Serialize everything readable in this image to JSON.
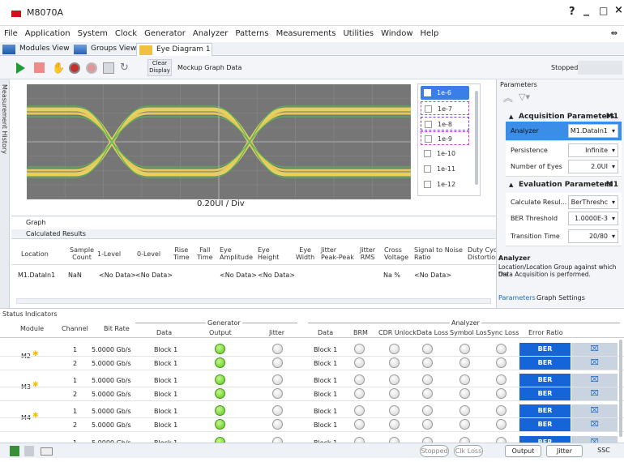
{
  "window": {
    "title": "M8070A",
    "controls": [
      "?",
      "_",
      "□",
      "×"
    ]
  },
  "menu": [
    "File",
    "Application",
    "System",
    "Clock",
    "Generator",
    "Analyzer",
    "Patterns",
    "Measurements",
    "Utilities",
    "Window",
    "Help"
  ],
  "tabs": [
    {
      "label": "Modules View",
      "icon": "modules-icon"
    },
    {
      "label": "Groups View",
      "icon": "groups-icon"
    },
    {
      "label": "Eye Diagram 1",
      "icon": "eye-diagram-icon",
      "close": "×"
    }
  ],
  "toolbar": {
    "clear_label": "Clear\nDisplay",
    "clear_l1": "Clear",
    "clear_l2": "Display",
    "mockup_label": "Mockup Graph Data",
    "status": "Stopped"
  },
  "side_panel": {
    "label": "Measurement History"
  },
  "graph": {
    "scale_label": "0.20UI / Div",
    "tab_label": "Graph"
  },
  "ber_levels": [
    {
      "label": "1e-6",
      "selected": true
    },
    {
      "label": "1e-7",
      "color": "#d63ad0"
    },
    {
      "label": "1e-8",
      "color": "#6e45d8"
    },
    {
      "label": "1e-9",
      "color": "#d63ad0"
    },
    {
      "label": "1e-10"
    },
    {
      "label": "1e-11"
    },
    {
      "label": "1e-12"
    }
  ],
  "results": {
    "section_title": "Calculated Results",
    "columns": [
      [
        "Location"
      ],
      [
        "Sample",
        "Count"
      ],
      [
        "1-Level"
      ],
      [
        "0-Level"
      ],
      [
        "Rise",
        "Time"
      ],
      [
        "Fall",
        "Time"
      ],
      [
        "Eye",
        "Amplitude"
      ],
      [
        "Eye",
        "Height"
      ],
      [
        "Eye",
        "Width"
      ],
      [
        "Jitter",
        "Peak-Peak"
      ],
      [
        "Jitter",
        "RMS"
      ],
      [
        "Cross",
        "Voltage"
      ],
      [
        "Signal to Noise",
        "Ratio"
      ],
      [
        "Duty Cyc",
        "Distortion"
      ]
    ],
    "row": {
      "location": "M1.DataIn1",
      "sample_count": "NaN",
      "one_level": "<No Data>",
      "zero_level": "<No Data>",
      "eye_amplitude": "<No Data>",
      "eye_height": "<No Data>",
      "cross_voltage": "Na %",
      "snr": "<No Data>"
    }
  },
  "parameters": {
    "title": "Parameters",
    "acq_title": "Acquisition Parameters",
    "acq_target": "M1",
    "acq": [
      {
        "label": "Analyzer",
        "value": "M1.DataIn1",
        "highlight": true
      },
      {
        "label": "Persistence",
        "value": "Infinite"
      },
      {
        "label": "Number of Eyes",
        "value": "2.0UI"
      }
    ],
    "eval_title": "Evaluation Parameters",
    "eval_target": "M1",
    "eval": [
      {
        "label": "Calculate Resul...",
        "value": "BerThreshc"
      },
      {
        "label": "BER Threshold",
        "value": "1.0000E-3"
      },
      {
        "label": "Transition Time",
        "value": "20/80"
      }
    ],
    "help_title": "Analyzer",
    "help_text_1": "Location/Location Group against which the",
    "help_text_2": "Data Acquisition is performed.",
    "tabs": [
      "Parameters",
      "Graph Settings"
    ]
  },
  "status": {
    "title": "Status Indicators",
    "group_generator": "Generator",
    "group_analyzer": "Analyzer",
    "headers": {
      "module": "Module",
      "channel": "Channel",
      "bit_rate": "Bit Rate",
      "data": "Data",
      "output": "Output",
      "jitter": "Jitter",
      "adata": "Data",
      "brm": "BRM",
      "cdr": "CDR Unlock",
      "dloss": "Data Loss",
      "symloss": "Symbol Los",
      "syncloss": "Sync Loss",
      "err": "Error Ratio"
    },
    "rows": [
      {
        "module": "M2",
        "channel": "1",
        "bit_rate": "5.0000 Gb/s",
        "data": "Block 1",
        "adata": "Block 1",
        "ber": "BER 0.00e+00"
      },
      {
        "module": "",
        "channel": "2",
        "bit_rate": "5.0000 Gb/s",
        "data": "Block 1",
        "adata": "Block 1",
        "ber": "BER 0.00e+00"
      },
      {
        "module": "M3",
        "channel": "1",
        "bit_rate": "5.0000 Gb/s",
        "data": "Block 1",
        "adata": "Block 1",
        "ber": "BER 0.00e+00"
      },
      {
        "module": "",
        "channel": "2",
        "bit_rate": "5.0000 Gb/s",
        "data": "Block 1",
        "adata": "Block 1",
        "ber": "BER 0.00e+00"
      },
      {
        "module": "M4",
        "channel": "1",
        "bit_rate": "5.0000 Gb/s",
        "data": "Block 1",
        "adata": "Block 1",
        "ber": "BER 0.00e+00"
      },
      {
        "module": "",
        "channel": "2",
        "bit_rate": "5.0000 Gb/s",
        "data": "Block 1",
        "adata": "Block 1",
        "ber": "BER 0.00e+00"
      },
      {
        "module": "M5",
        "channel": "1",
        "bit_rate": "5.0000 Gb/s",
        "data": "Block 1",
        "adata": "Block 1",
        "ber": "BER 0.00e+00"
      }
    ]
  },
  "footer": {
    "stopped": "Stopped",
    "clk_loss": "Clk Loss",
    "output": "Output",
    "jitter": "Jitter",
    "ssc": "SSC"
  }
}
